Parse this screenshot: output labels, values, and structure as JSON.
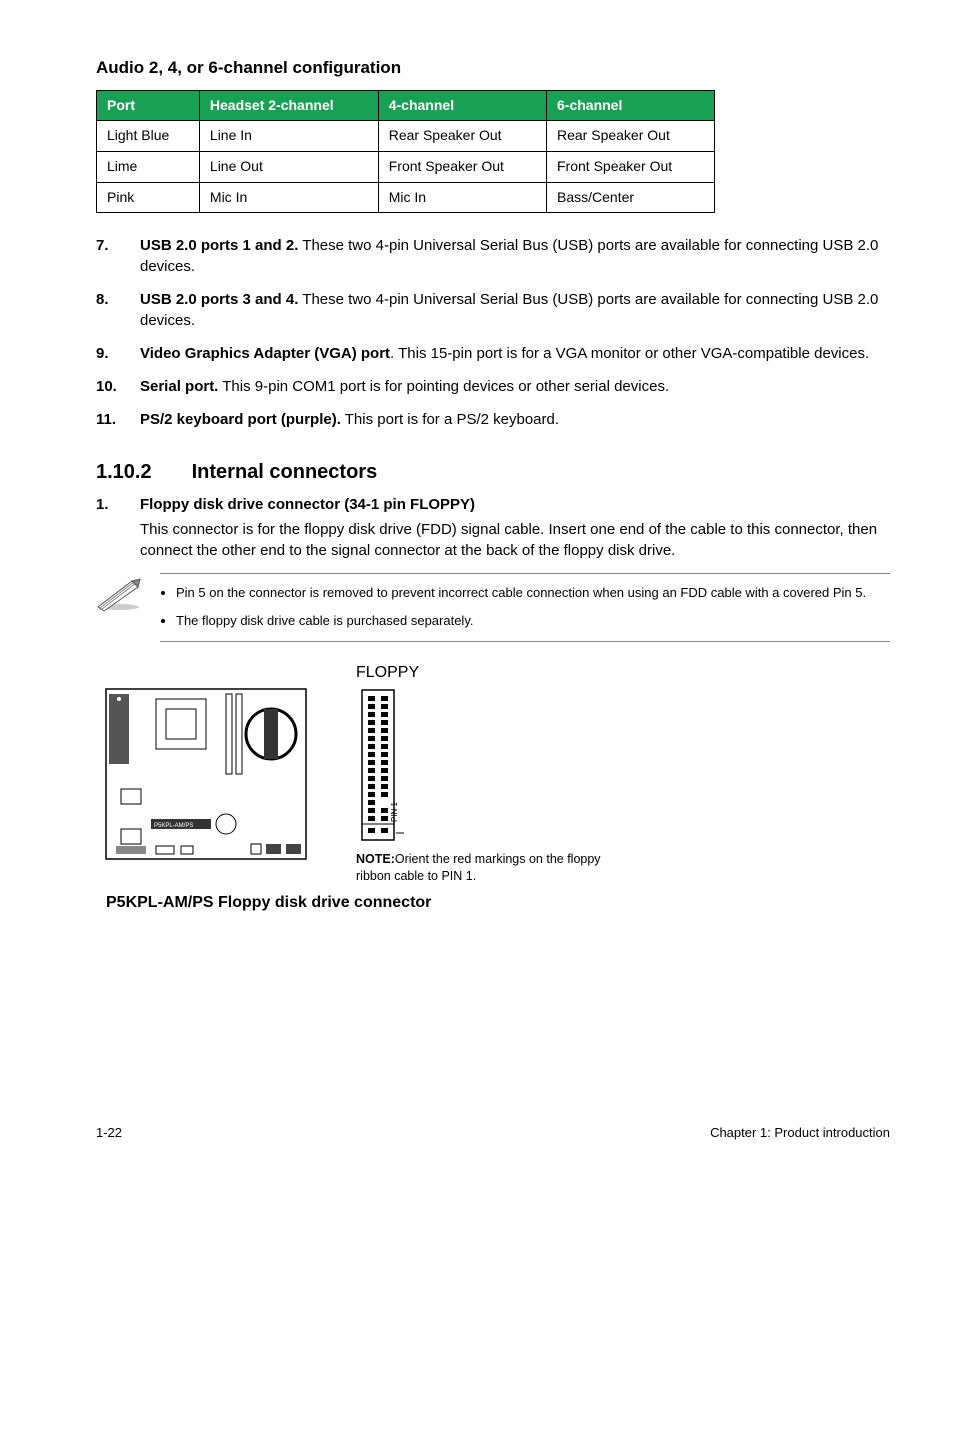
{
  "section": {
    "audio_heading": "Audio 2, 4, or 6-channel configuration",
    "table": {
      "headers": {
        "port": "Port",
        "headset": "Headset 2-channel",
        "ch4": "4-channel",
        "ch6": "6-channel"
      },
      "rows": [
        {
          "port": "Light Blue",
          "headset": "Line In",
          "ch4": "Rear Speaker Out",
          "ch6": "Rear Speaker Out"
        },
        {
          "port": "Lime",
          "headset": "Line Out",
          "ch4": "Front Speaker Out",
          "ch6": "Front Speaker Out"
        },
        {
          "port": "Pink",
          "headset": "Mic In",
          "ch4": "Mic In",
          "ch6": "Bass/Center"
        }
      ]
    },
    "port_items": [
      {
        "num": "7.",
        "title": "USB 2.0 ports 1 and 2.",
        "text": " These two 4-pin Universal Serial Bus (USB) ports are available for connecting USB 2.0 devices."
      },
      {
        "num": "8.",
        "title": "USB 2.0 ports 3 and 4.",
        "text": " These two 4-pin Universal Serial Bus (USB) ports are available for connecting USB 2.0 devices."
      },
      {
        "num": "9.",
        "title": "Video Graphics Adapter (VGA) port",
        "text": ". This 15-pin port is for a VGA monitor or other VGA-compatible devices."
      },
      {
        "num": "10.",
        "title": "Serial port.",
        "text": " This 9-pin COM1 port is for pointing devices or other serial devices."
      },
      {
        "num": "11.",
        "title": "PS/2 keyboard port (purple).",
        "text": " This port is for a PS/2 keyboard."
      }
    ],
    "subsection": {
      "number": "1.10.2",
      "title": "Internal connectors",
      "item_num": "1.",
      "item_title": "Floppy disk drive connector (34-1 pin FLOPPY)",
      "item_body": "This connector is for the floppy disk drive (FDD) signal cable. Insert one end of the cable to this connector, then connect the other end to the signal connector at the back of the floppy disk drive."
    },
    "notes": [
      "Pin 5 on the connector is removed to prevent incorrect cable connection when using an FDD cable with a covered Pin 5.",
      "The floppy disk drive cable is purchased separately."
    ],
    "diagram": {
      "conn_label": "FLOPPY",
      "pin_label": "PIN 1",
      "note_bold": "NOTE:",
      "note_text": "Orient the red markings on the floppy ribbon cable to PIN 1.",
      "caption": "P5KPL-AM/PS Floppy disk drive connector"
    },
    "footer": {
      "page": "1-22",
      "chapter": "Chapter 1: Product introduction"
    }
  }
}
